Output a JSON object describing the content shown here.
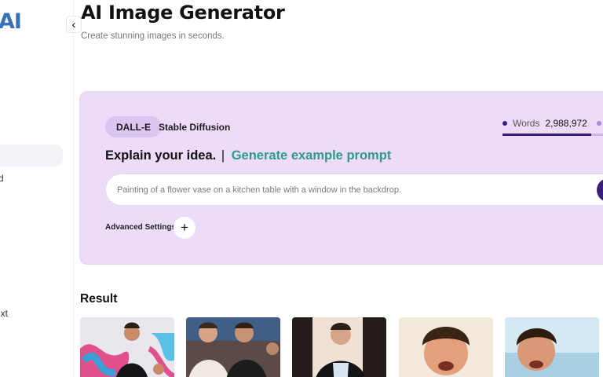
{
  "sidebar": {
    "logo": "AI",
    "items": [
      {
        "label": "rd"
      },
      {
        "label": "ext"
      }
    ]
  },
  "header": {
    "title": "AI Image Generator",
    "subtitle": "Create stunning images in seconds."
  },
  "generator": {
    "models": [
      {
        "label": "DALL-E",
        "active": true
      },
      {
        "label": "Stable Diffusion",
        "active": false
      }
    ],
    "usage": {
      "label": "Words",
      "value": "2,988,972",
      "progress_fraction": 0.88
    },
    "prompt_heading": "Explain your idea.",
    "separator": "|",
    "example_link": "Generate example prompt",
    "prompt_placeholder": "Painting of a flower vase on a kitchen table with a window in the backdrop.",
    "advanced_label": "Advanced Settings"
  },
  "results": {
    "title": "Result",
    "images": [
      {
        "name": "result-image-1"
      },
      {
        "name": "result-image-2"
      },
      {
        "name": "result-image-3"
      },
      {
        "name": "result-image-4"
      },
      {
        "name": "result-image-5"
      }
    ]
  },
  "colors": {
    "panel_bg": "#ecdcfa",
    "accent_dark": "#3a1f7a",
    "link_teal": "#2f9a86",
    "logo_blue": "#3b6fb6"
  }
}
